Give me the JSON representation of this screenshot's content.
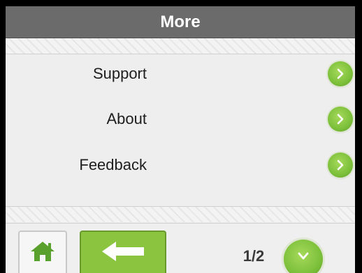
{
  "header": {
    "title": "More"
  },
  "menu": {
    "items": [
      {
        "label": "Support",
        "icon": "chevron-right-icon"
      },
      {
        "label": "About",
        "icon": "chevron-right-icon"
      },
      {
        "label": "Feedback",
        "icon": "chevron-right-icon"
      }
    ]
  },
  "footer": {
    "home_icon": "home-icon",
    "back_icon": "arrow-left-icon",
    "page_indicator": "1/2",
    "page_down_icon": "chevron-down-icon"
  },
  "colors": {
    "header_bg": "#6b6b6b",
    "accent_green": "#8bc53f",
    "home_green": "#5aa02c",
    "background": "#eeeeee"
  }
}
